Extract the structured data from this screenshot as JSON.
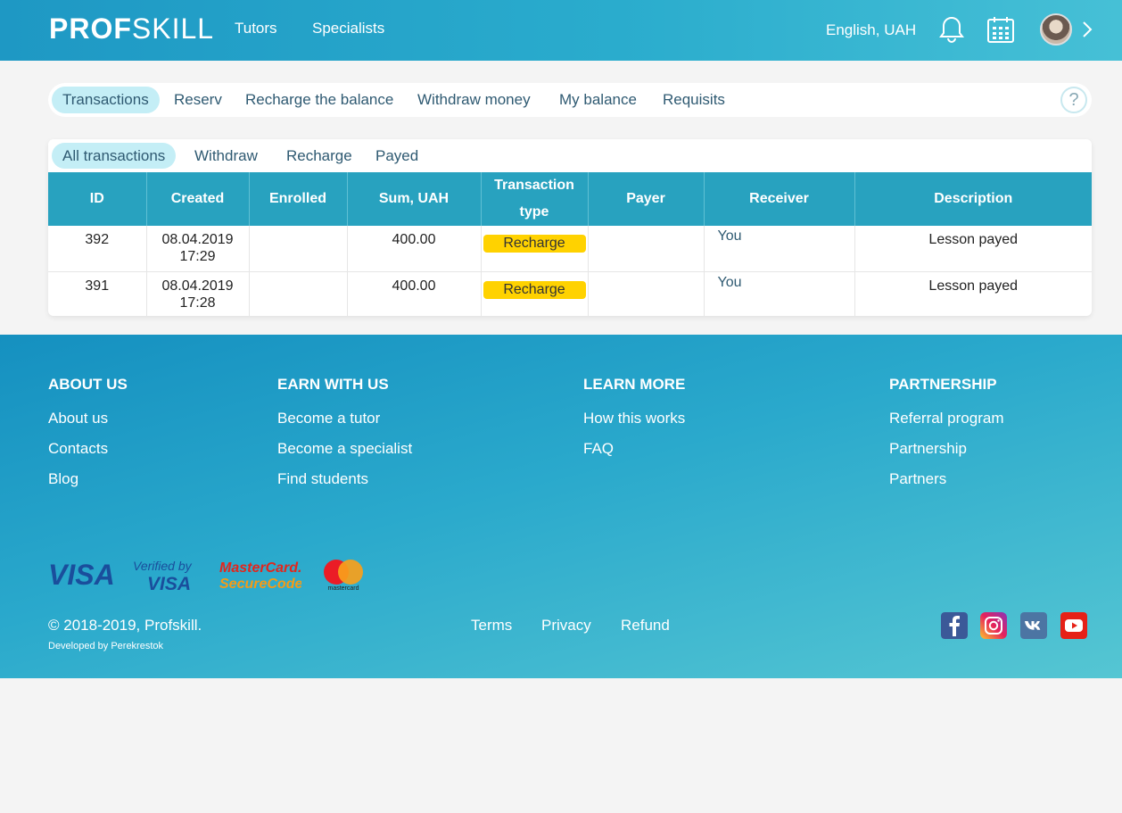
{
  "header": {
    "logo_bold": "PROF",
    "logo_light": "SKILL",
    "nav": [
      "Tutors",
      "Specialists"
    ],
    "language": "English, UAH"
  },
  "tabs": [
    "Transactions",
    "Reserv",
    "Recharge the balance",
    "Withdraw money",
    "My balance",
    "Requisits"
  ],
  "help_label": "?",
  "subtabs": [
    "All transactions",
    "Withdraw",
    "Recharge",
    "Payed"
  ],
  "table": {
    "columns": [
      "ID",
      "Created",
      "Enrolled",
      "Sum, UAH",
      "Transaction type",
      "Payer",
      "Receiver",
      "Description"
    ],
    "rows": [
      {
        "id": "392",
        "created_date": "08.04.2019",
        "created_time": "17:29",
        "enrolled": "",
        "sum": "400.00",
        "type": "Recharge",
        "payer": "",
        "receiver": "You",
        "description": "Lesson payed"
      },
      {
        "id": "391",
        "created_date": "08.04.2019",
        "created_time": "17:28",
        "enrolled": "",
        "sum": "400.00",
        "type": "Recharge",
        "payer": "",
        "receiver": "You",
        "description": "Lesson payed"
      }
    ]
  },
  "footer": {
    "about": {
      "heading": "ABOUT US",
      "links": [
        "About us",
        "Contacts",
        "Blog"
      ]
    },
    "earn": {
      "heading": "EARN WITH US",
      "links": [
        "Become a tutor",
        "Become a specialist",
        "Find students"
      ]
    },
    "learn": {
      "heading": "LEARN MORE",
      "links": [
        "How this works",
        "FAQ"
      ]
    },
    "partnership": {
      "heading": "PARTNERSHIP",
      "links": [
        "Referral program",
        "Partnership",
        "Partners"
      ]
    },
    "payment_logos": [
      "VISA",
      "Verified by",
      "VISA",
      "MasterCard.",
      "SecureCode.",
      "mastercard"
    ],
    "copyright": "© 2018-2019, Profskill.",
    "developer": "Developed by Perekrestok",
    "legal": [
      "Terms",
      "Privacy",
      "Refund"
    ],
    "social_icons": [
      "facebook-icon",
      "instagram-icon",
      "vk-icon",
      "youtube-icon"
    ]
  },
  "colors": {
    "accent": "#28a2bf",
    "badge": "#ffd200",
    "active_tab": "#c4eef6"
  }
}
